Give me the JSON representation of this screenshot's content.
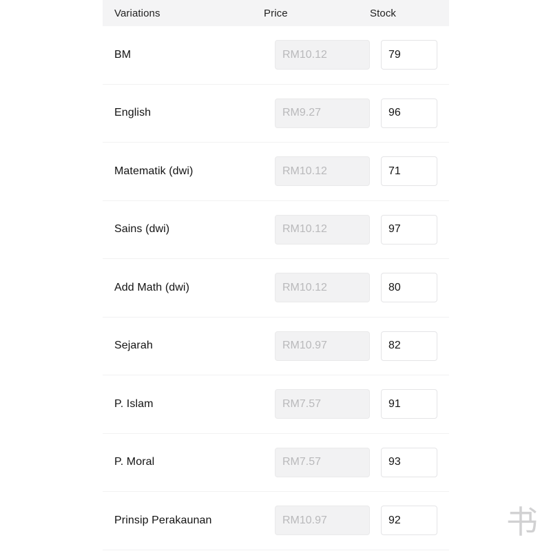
{
  "table": {
    "columns": {
      "variations": "Variations",
      "price": "Price",
      "stock": "Stock"
    },
    "rows": [
      {
        "variation": "BM",
        "price_placeholder": "RM10.12",
        "price_value": "",
        "stock_value": "79"
      },
      {
        "variation": "English",
        "price_placeholder": "RM9.27",
        "price_value": "",
        "stock_value": "96"
      },
      {
        "variation": "Matematik (dwi)",
        "price_placeholder": "RM10.12",
        "price_value": "",
        "stock_value": "71"
      },
      {
        "variation": "Sains (dwi)",
        "price_placeholder": "RM10.12",
        "price_value": "",
        "stock_value": "97"
      },
      {
        "variation": "Add Math (dwi)",
        "price_placeholder": "RM10.12",
        "price_value": "",
        "stock_value": "80"
      },
      {
        "variation": "Sejarah",
        "price_placeholder": "RM10.97",
        "price_value": "",
        "stock_value": "82"
      },
      {
        "variation": "P. Islam",
        "price_placeholder": "RM7.57",
        "price_value": "",
        "stock_value": "91"
      },
      {
        "variation": "P. Moral",
        "price_placeholder": "RM7.57",
        "price_value": "",
        "stock_value": "93"
      },
      {
        "variation": "Prinsip Perakaunan",
        "price_placeholder": "RM10.97",
        "price_value": "",
        "stock_value": "92"
      }
    ]
  },
  "watermark": {
    "glyph": "书",
    "name": "watermark-glyph"
  },
  "colors": {
    "header_background": "#f4f4f5",
    "row_divider": "#f1f1f2",
    "price_field_background": "#f2f2f3",
    "price_placeholder_text": "#b9b9bb",
    "stock_field_border": "#e4e4e6",
    "text_primary": "#131313",
    "page_background": "#ffffff"
  }
}
